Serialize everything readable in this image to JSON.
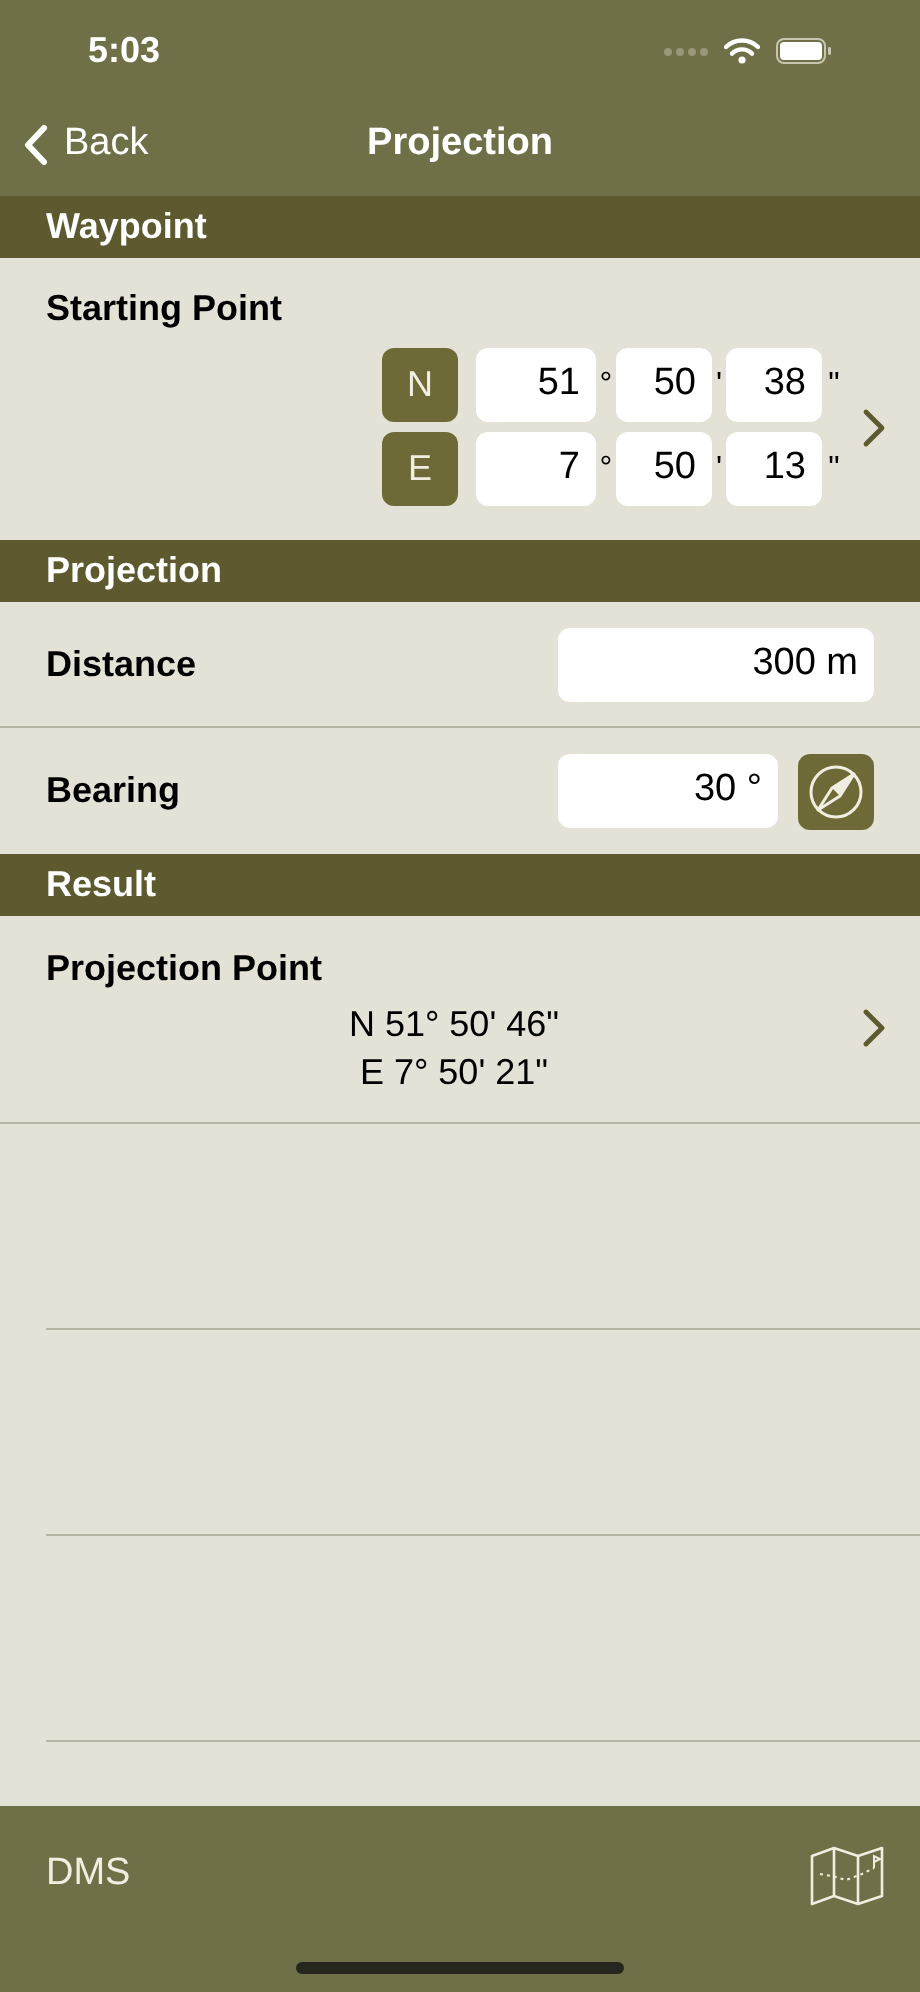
{
  "status_bar": {
    "time": "5:03"
  },
  "nav": {
    "back": "Back",
    "title": "Projection"
  },
  "waypoint": {
    "header": "Waypoint",
    "label": "Starting Point",
    "coords": [
      {
        "hemisphere": "N",
        "deg": "51",
        "deg_unit": "°",
        "min": "50",
        "min_unit": "'",
        "sec": "38",
        "sec_unit": "\""
      },
      {
        "hemisphere": "E",
        "deg": "7",
        "deg_unit": "°",
        "min": "50",
        "min_unit": "'",
        "sec": "13",
        "sec_unit": "\""
      }
    ]
  },
  "projection": {
    "header": "Projection",
    "rows": [
      {
        "kind": "distance",
        "label": "Distance",
        "value": "300 m"
      },
      {
        "kind": "bearing",
        "label": "Bearing",
        "value": "30 °"
      }
    ]
  },
  "result": {
    "header": "Result",
    "label": "Projection Point",
    "lines": [
      "N 51° 50' 46\"",
      "E 7° 50' 21\""
    ]
  },
  "toolbar": {
    "format": "DMS"
  }
}
